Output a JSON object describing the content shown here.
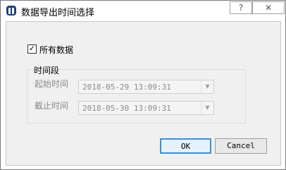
{
  "window": {
    "title": "数据导出时间选择",
    "help_label": "?",
    "close_label": "✕"
  },
  "export_all": {
    "label": "所有数据",
    "checked": true,
    "check_glyph": "✓"
  },
  "time_range": {
    "group_title": "时间段",
    "start": {
      "label": "起始时间",
      "value": "2018-05-29 13:09:31"
    },
    "end": {
      "label": "截止时间",
      "value": "2018-05-30 13:09:31"
    }
  },
  "buttons": {
    "ok_label": "OK",
    "cancel_label": "Cancel"
  },
  "colors": {
    "accent": "#3c8fd7",
    "app_icon": "#1f3f7a"
  }
}
